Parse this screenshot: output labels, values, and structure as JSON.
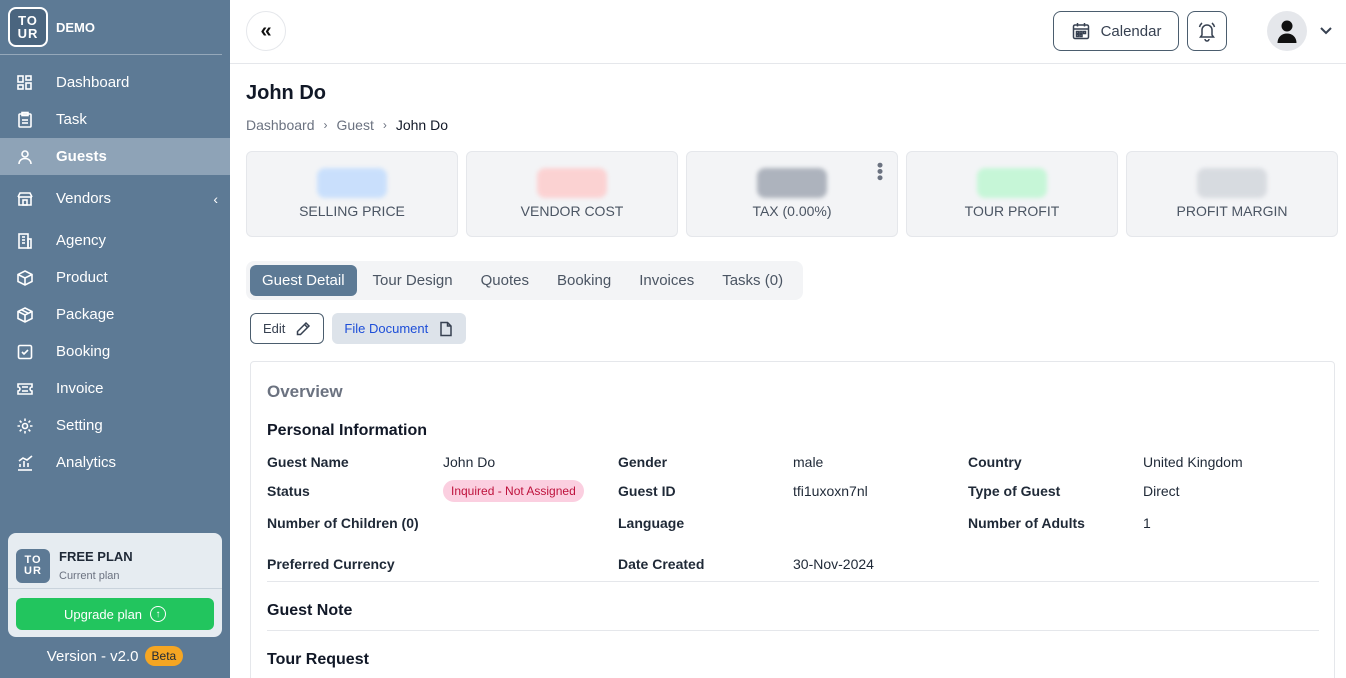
{
  "brand": {
    "logo_top": "TO",
    "logo_bottom": "UR",
    "name": "DEMO"
  },
  "sidebar": {
    "items": [
      {
        "label": "Dashboard",
        "icon": "dashboard-icon"
      },
      {
        "label": "Task",
        "icon": "clipboard-icon"
      },
      {
        "label": "Guests",
        "icon": "user-icon",
        "active": true
      },
      {
        "label": "Vendors",
        "icon": "store-icon",
        "chevron": "‹"
      },
      {
        "label": "Agency",
        "icon": "building-icon"
      },
      {
        "label": "Product",
        "icon": "box-icon"
      },
      {
        "label": "Package",
        "icon": "package-icon"
      },
      {
        "label": "Booking",
        "icon": "check-square-icon"
      },
      {
        "label": "Invoice",
        "icon": "ticket-icon"
      },
      {
        "label": "Setting",
        "icon": "gear-icon"
      },
      {
        "label": "Analytics",
        "icon": "chart-icon"
      }
    ],
    "plan": {
      "title": "FREE PLAN",
      "subtitle": "Current plan",
      "upgrade_label": "Upgrade plan"
    },
    "version": "Version - v2.0",
    "beta": "Beta"
  },
  "header": {
    "calendar_label": "Calendar"
  },
  "page": {
    "title": "John Do",
    "breadcrumb": [
      "Dashboard",
      "Guest",
      "John Do"
    ]
  },
  "stats": [
    {
      "label": "SELLING PRICE",
      "color": "#bfdbfe"
    },
    {
      "label": "VENDOR COST",
      "color": "#fecaca"
    },
    {
      "label": "TAX (0.00%)",
      "color": "#9ca3af"
    },
    {
      "label": "TOUR PROFIT",
      "color": "#bbf7d0"
    },
    {
      "label": "PROFIT MARGIN",
      "color": "#d1d5db"
    }
  ],
  "tabs": [
    "Guest Detail",
    "Tour Design",
    "Quotes",
    "Booking",
    "Invoices",
    "Tasks (0)"
  ],
  "actions": {
    "edit_label": "Edit",
    "file_label": "File Document"
  },
  "overview": {
    "heading": "Overview",
    "personal_title": "Personal Information",
    "fields": {
      "guest_name_label": "Guest Name",
      "guest_name": "John Do",
      "gender_label": "Gender",
      "gender": "male",
      "country_label": "Country",
      "country": "United Kingdom",
      "status_label": "Status",
      "status": "Inquired - Not Assigned",
      "guest_id_label": "Guest ID",
      "guest_id": "tfi1uxoxn7nl",
      "type_label": "Type of Guest",
      "type": "Direct",
      "children_label": "Number of Children (0)",
      "language_label": "Language",
      "adults_label": "Number of Adults",
      "adults": "1",
      "currency_label": "Preferred Currency",
      "date_label": "Date Created",
      "date": "30-Nov-2024"
    },
    "guest_note_title": "Guest Note",
    "tour_request_title": "Tour Request"
  }
}
